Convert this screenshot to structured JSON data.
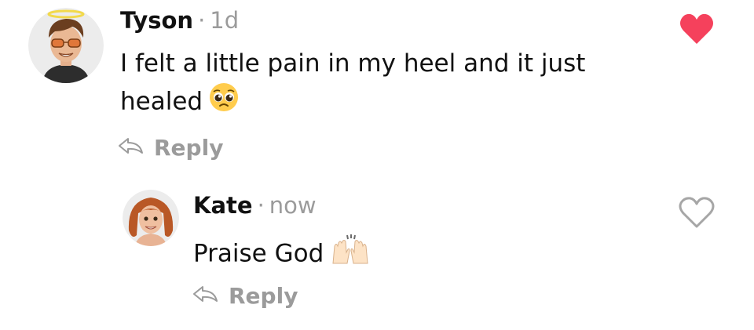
{
  "comments": [
    {
      "author": "Tyson",
      "separator": "·",
      "time": "1d",
      "text": "I felt a little pain in my heel and it just healed",
      "emoji": "pleading-face",
      "reply_label": "Reply",
      "liked": true
    },
    {
      "author": "Kate",
      "separator": "·",
      "time": "now",
      "text": "Praise God",
      "emoji": "raising-hands",
      "reply_label": "Reply",
      "liked": false
    }
  ],
  "colors": {
    "like_active": "#f5415c",
    "like_inactive": "#a6a6a6",
    "meta_gray": "#9b9b9b",
    "text": "#111111"
  },
  "icons": {
    "reply": "reply-arrow-icon",
    "like": "heart-icon"
  }
}
